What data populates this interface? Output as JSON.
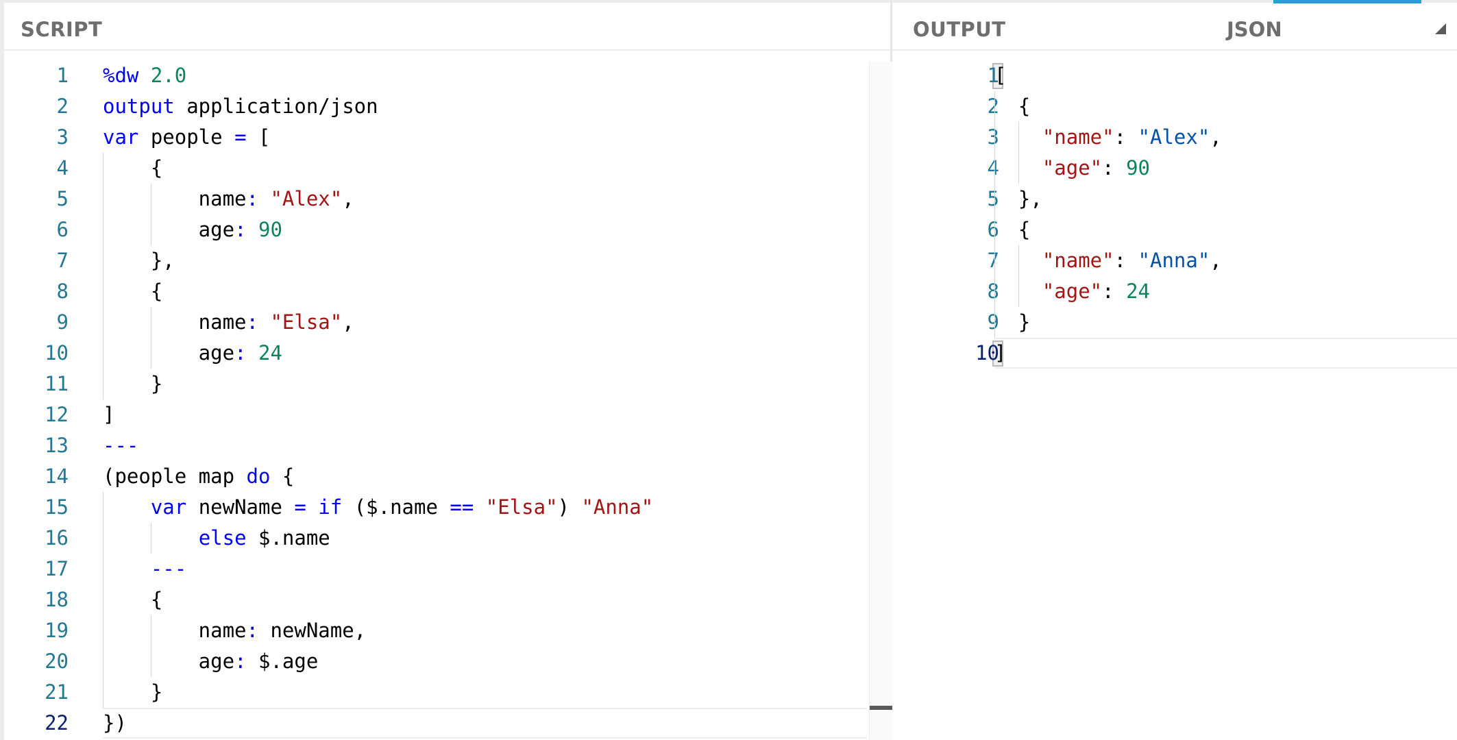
{
  "script_pane": {
    "title": "SCRIPT",
    "lines": [
      {
        "n": "1",
        "tokens": [
          {
            "t": "%dw ",
            "c": "key"
          },
          {
            "t": "2.0",
            "c": "num"
          }
        ]
      },
      {
        "n": "2",
        "tokens": [
          {
            "t": "output ",
            "c": "key"
          },
          {
            "t": "application/json",
            "c": "punc"
          }
        ]
      },
      {
        "n": "3",
        "tokens": [
          {
            "t": "var ",
            "c": "key"
          },
          {
            "t": "people ",
            "c": "punc"
          },
          {
            "t": "=",
            "c": "key"
          },
          {
            "t": " [",
            "c": "punc"
          }
        ]
      },
      {
        "n": "4",
        "tokens": [
          {
            "t": "    {",
            "c": "punc"
          }
        ]
      },
      {
        "n": "5",
        "tokens": [
          {
            "t": "        name",
            "c": "punc"
          },
          {
            "t": ":",
            "c": "key"
          },
          {
            "t": " ",
            "c": "punc"
          },
          {
            "t": "\"Alex\"",
            "c": "str"
          },
          {
            "t": ",",
            "c": "punc"
          }
        ]
      },
      {
        "n": "6",
        "tokens": [
          {
            "t": "        age",
            "c": "punc"
          },
          {
            "t": ":",
            "c": "key"
          },
          {
            "t": " ",
            "c": "punc"
          },
          {
            "t": "90",
            "c": "num"
          }
        ]
      },
      {
        "n": "7",
        "tokens": [
          {
            "t": "    },",
            "c": "punc"
          }
        ]
      },
      {
        "n": "8",
        "tokens": [
          {
            "t": "    {",
            "c": "punc"
          }
        ]
      },
      {
        "n": "9",
        "tokens": [
          {
            "t": "        name",
            "c": "punc"
          },
          {
            "t": ":",
            "c": "key"
          },
          {
            "t": " ",
            "c": "punc"
          },
          {
            "t": "\"Elsa\"",
            "c": "str"
          },
          {
            "t": ",",
            "c": "punc"
          }
        ]
      },
      {
        "n": "10",
        "tokens": [
          {
            "t": "        age",
            "c": "punc"
          },
          {
            "t": ":",
            "c": "key"
          },
          {
            "t": " ",
            "c": "punc"
          },
          {
            "t": "24",
            "c": "num"
          }
        ]
      },
      {
        "n": "11",
        "tokens": [
          {
            "t": "    }",
            "c": "punc"
          }
        ]
      },
      {
        "n": "12",
        "tokens": [
          {
            "t": "]",
            "c": "punc"
          }
        ]
      },
      {
        "n": "13",
        "tokens": [
          {
            "t": "---",
            "c": "key"
          }
        ]
      },
      {
        "n": "14",
        "tokens": [
          {
            "t": "(people map ",
            "c": "punc"
          },
          {
            "t": "do",
            "c": "key"
          },
          {
            "t": " {",
            "c": "punc"
          }
        ]
      },
      {
        "n": "15",
        "tokens": [
          {
            "t": "    ",
            "c": "punc"
          },
          {
            "t": "var ",
            "c": "key"
          },
          {
            "t": "newName ",
            "c": "punc"
          },
          {
            "t": "=",
            "c": "key"
          },
          {
            "t": " ",
            "c": "punc"
          },
          {
            "t": "if",
            "c": "key"
          },
          {
            "t": " ($.name ",
            "c": "punc"
          },
          {
            "t": "==",
            "c": "key"
          },
          {
            "t": " ",
            "c": "punc"
          },
          {
            "t": "\"Elsa\"",
            "c": "str"
          },
          {
            "t": ") ",
            "c": "punc"
          },
          {
            "t": "\"Anna\"",
            "c": "str"
          }
        ]
      },
      {
        "n": "16",
        "tokens": [
          {
            "t": "        ",
            "c": "punc"
          },
          {
            "t": "else",
            "c": "key"
          },
          {
            "t": " $.name",
            "c": "punc"
          }
        ]
      },
      {
        "n": "17",
        "tokens": [
          {
            "t": "    ---",
            "c": "key"
          }
        ]
      },
      {
        "n": "18",
        "tokens": [
          {
            "t": "    {",
            "c": "punc"
          }
        ]
      },
      {
        "n": "19",
        "tokens": [
          {
            "t": "        name",
            "c": "punc"
          },
          {
            "t": ":",
            "c": "key"
          },
          {
            "t": " newName,",
            "c": "punc"
          }
        ]
      },
      {
        "n": "20",
        "tokens": [
          {
            "t": "        age",
            "c": "punc"
          },
          {
            "t": ":",
            "c": "key"
          },
          {
            "t": " $.age",
            "c": "punc"
          }
        ]
      },
      {
        "n": "21",
        "tokens": [
          {
            "t": "    }",
            "c": "punc"
          }
        ]
      },
      {
        "n": "22",
        "tokens": [
          {
            "t": "})",
            "c": "punc"
          }
        ],
        "current": true
      }
    ]
  },
  "output_pane": {
    "title": "OUTPUT",
    "format": "JSON",
    "lines": [
      {
        "n": "1",
        "tokens": [
          {
            "t": "[",
            "c": "punc"
          }
        ]
      },
      {
        "n": "2",
        "tokens": [
          {
            "t": "  {",
            "c": "punc"
          }
        ]
      },
      {
        "n": "3",
        "tokens": [
          {
            "t": "    ",
            "c": "punc"
          },
          {
            "t": "\"name\"",
            "c": "prop"
          },
          {
            "t": ": ",
            "c": "punc"
          },
          {
            "t": "\"Alex\"",
            "c": "val"
          },
          {
            "t": ",",
            "c": "punc"
          }
        ]
      },
      {
        "n": "4",
        "tokens": [
          {
            "t": "    ",
            "c": "punc"
          },
          {
            "t": "\"age\"",
            "c": "prop"
          },
          {
            "t": ": ",
            "c": "punc"
          },
          {
            "t": "90",
            "c": "num"
          }
        ]
      },
      {
        "n": "5",
        "tokens": [
          {
            "t": "  },",
            "c": "punc"
          }
        ]
      },
      {
        "n": "6",
        "tokens": [
          {
            "t": "  {",
            "c": "punc"
          }
        ]
      },
      {
        "n": "7",
        "tokens": [
          {
            "t": "    ",
            "c": "punc"
          },
          {
            "t": "\"name\"",
            "c": "prop"
          },
          {
            "t": ": ",
            "c": "punc"
          },
          {
            "t": "\"Anna\"",
            "c": "val"
          },
          {
            "t": ",",
            "c": "punc"
          }
        ]
      },
      {
        "n": "8",
        "tokens": [
          {
            "t": "    ",
            "c": "punc"
          },
          {
            "t": "\"age\"",
            "c": "prop"
          },
          {
            "t": ": ",
            "c": "punc"
          },
          {
            "t": "24",
            "c": "num"
          }
        ]
      },
      {
        "n": "9",
        "tokens": [
          {
            "t": "  }",
            "c": "punc"
          }
        ]
      },
      {
        "n": "10",
        "tokens": [
          {
            "t": "]",
            "c": "punc"
          }
        ],
        "current": true
      }
    ]
  },
  "icons": {
    "format_dropdown": "triangle-down-right-icon"
  }
}
